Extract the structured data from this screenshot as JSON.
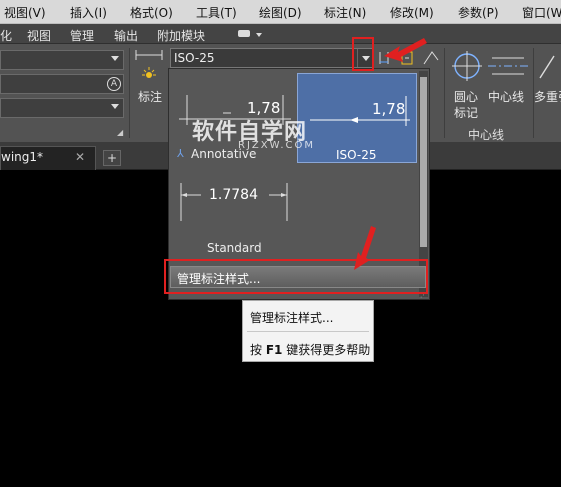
{
  "menubar": {
    "items": [
      "视图(V)",
      "插入(I)",
      "格式(O)",
      "工具(T)",
      "绘图(D)",
      "标注(N)",
      "修改(M)",
      "参数(P)",
      "窗口(W"
    ]
  },
  "ribbon_tabs": {
    "items": [
      "化",
      "视图",
      "管理",
      "输出",
      "附加模块"
    ]
  },
  "ribbon": {
    "dim_label": "标注",
    "style_combo_value": "ISO-25",
    "center_mark_label_1": "圆心",
    "center_mark_label_2": "标记",
    "centerline_label": "中心线",
    "multileader_label": "多重引",
    "centerline_panel_title": "中心线"
  },
  "file_tab": {
    "name": "wing1*",
    "add": "+"
  },
  "dropdown": {
    "styles": [
      {
        "name": "Annotative",
        "sample": "1,78"
      },
      {
        "name": "ISO-25",
        "sample": "1,78"
      },
      {
        "name": "Standard",
        "sample": "1.7784"
      }
    ],
    "manage_label": "管理标注样式..."
  },
  "tooltip": {
    "title": "管理标注样式...",
    "help_prefix": "按 ",
    "help_key": "F1",
    "help_suffix": " 键获得更多帮助"
  },
  "watermark": {
    "title": "软件自学网",
    "url": "RJZXW.COM"
  },
  "colors": {
    "annotation_red": "#e02020",
    "selected_style_blue": "#4e6fa6",
    "canvas": "#000000"
  }
}
